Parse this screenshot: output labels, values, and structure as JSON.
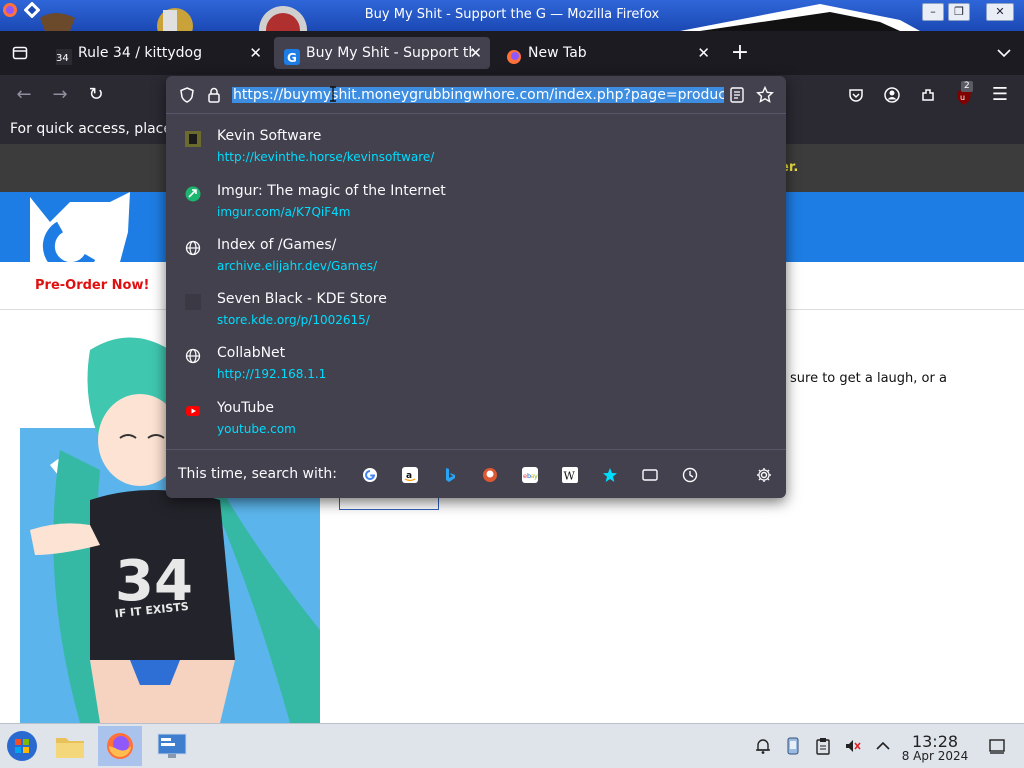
{
  "window": {
    "title": "Buy My Shit - Support the G — Mozilla Firefox"
  },
  "tabs": [
    {
      "label": "Rule 34 / kittydog",
      "icon": "rule34-favicon",
      "active": false
    },
    {
      "label": "Buy My Shit - Support the G",
      "icon": "site-g-favicon",
      "active": true
    },
    {
      "label": "New Tab",
      "icon": "firefox-icon",
      "active": false
    }
  ],
  "urlbar": {
    "value": "https://buymyshit.moneygrubbingwhore.com/index.php?page=product"
  },
  "bookmarks_bar": {
    "text": "For quick access, place"
  },
  "extensions": {
    "ublock_badge": "2"
  },
  "suggestions": [
    {
      "title": "Kevin Software",
      "url": "http://kevinthe.horse/kevinsoftware/",
      "icon": "kevin-favicon"
    },
    {
      "title": "Imgur: The magic of the Internet",
      "url": "imgur.com/a/K7QiF4m",
      "icon": "imgur-favicon"
    },
    {
      "title": "Index of /Games/",
      "url": "archive.elijahr.dev/Games/",
      "icon": "globe-icon"
    },
    {
      "title": "Seven Black - KDE Store",
      "url": "store.kde.org/p/1002615/",
      "icon": "kde-favicon"
    },
    {
      "title": "CollabNet",
      "url": "http://192.168.1.1",
      "icon": "globe-icon"
    },
    {
      "title": "YouTube",
      "url": "youtube.com",
      "icon": "youtube-favicon"
    }
  ],
  "search_with": {
    "label": "This time, search with:"
  },
  "site": {
    "notice_tail": "er.",
    "nav_preorder": "Pre-Order Now!",
    "body_tail": "sure to get a laugh, or a",
    "shirt_text": "34",
    "shirt_subtext": "IF IT EXISTS"
  },
  "clock": {
    "time": "13:28",
    "date": "8 Apr 2024"
  },
  "colors": {
    "accent_url": "#00ddff",
    "selection": "#3d8ee0",
    "panel": "#42414d",
    "tabbar": "#1c1b22"
  }
}
